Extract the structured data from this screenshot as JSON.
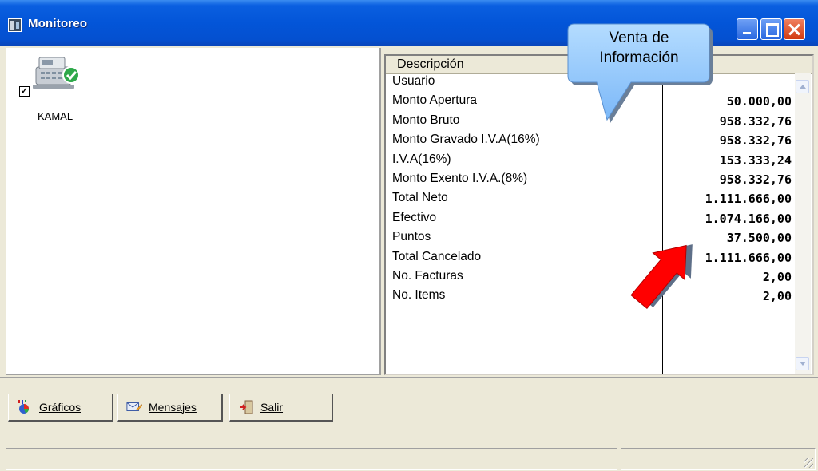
{
  "window": {
    "title": "Monitoreo"
  },
  "stations": [
    {
      "label": "KAMAL",
      "checked": true,
      "icon": "cash-register-icon",
      "status_icon": "check-icon"
    }
  ],
  "grid": {
    "header": "Descripción",
    "rows": [
      {
        "desc": "Usuario",
        "value": ""
      },
      {
        "desc": "Monto Apertura",
        "value": "50.000,00"
      },
      {
        "desc": "Monto Bruto",
        "value": "958.332,76"
      },
      {
        "desc": "Monto Gravado I.V.A(16%)",
        "value": "958.332,76"
      },
      {
        "desc": "I.V.A(16%)",
        "value": "153.333,24"
      },
      {
        "desc": "Monto Exento I.V.A.(8%)",
        "value": "958.332,76"
      },
      {
        "desc": "Total Neto",
        "value": "1.111.666,00"
      },
      {
        "desc": "Efectivo",
        "value": "1.074.166,00"
      },
      {
        "desc": "Puntos",
        "value": "37.500,00"
      },
      {
        "desc": "Total Cancelado",
        "value": "1.111.666,00"
      },
      {
        "desc": "No. Facturas",
        "value": "2,00"
      },
      {
        "desc": "No. Items",
        "value": "2,00"
      }
    ]
  },
  "buttons": {
    "graficos": "Gráficos",
    "mensajes": "Mensajes",
    "salir": "Salir"
  },
  "callout": {
    "line1": "Venta de",
    "line2": "Información"
  },
  "colors": {
    "titlebar": "#0355d8",
    "callout_fill": "#8cc2ff",
    "arrow": "#ff0000"
  }
}
